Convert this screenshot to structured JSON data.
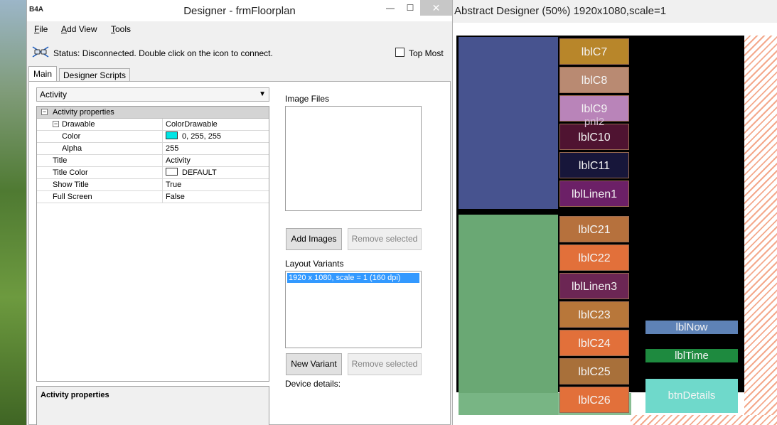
{
  "abstract_designer": {
    "title": "Abstract Designer (50%) 1920x1080,scale=1",
    "labels": [
      {
        "name": "lblC7",
        "text": "lblC7",
        "color": "#b8862a"
      },
      {
        "name": "lblC8",
        "text": "lblC8",
        "color": "#b98a72"
      },
      {
        "name": "lblC9",
        "text": "lblC9",
        "color": "#b984b9"
      },
      {
        "name": "lblC10",
        "text": "lblC10",
        "color": "#4f1331"
      },
      {
        "name": "lblC11",
        "text": "lblC11",
        "color": "#17163a"
      },
      {
        "name": "lblLinen1",
        "text": "lblLinen1",
        "color": "#6c2067"
      },
      {
        "name": "lblC21",
        "text": "lblC21",
        "color": "#b6713d"
      },
      {
        "name": "lblC22",
        "text": "lblC22",
        "color": "#e2703a"
      },
      {
        "name": "lblLinen3",
        "text": "lblLinen3",
        "color": "#6c2654"
      },
      {
        "name": "lblC23",
        "text": "lblC23",
        "color": "#b8773a"
      },
      {
        "name": "lblC24",
        "text": "lblC24",
        "color": "#e2703a"
      },
      {
        "name": "lblC25",
        "text": "lblC25",
        "color": "#a8703a"
      },
      {
        "name": "lblC26",
        "text": "lblC26",
        "color": "#e2703a"
      }
    ],
    "pnl2_label": "pnl2",
    "right_labels": [
      {
        "name": "lblNow",
        "text": "lblNow",
        "color": "#5e82b6"
      },
      {
        "name": "lblTime",
        "text": "lblTime",
        "color": "#1e8a3f"
      },
      {
        "name": "btnDetails",
        "text": "btnDetails",
        "color": "#6fd9cb"
      }
    ]
  },
  "designer": {
    "logo": "B4A",
    "title": "Designer - frmFloorplan",
    "window_buttons": {
      "minimize": "—",
      "maximize": "☐",
      "close": "✕"
    },
    "menu": [
      {
        "key": "F",
        "rest": "ile"
      },
      {
        "key": "A",
        "rest": "dd View"
      },
      {
        "key": "T",
        "rest": "ools"
      }
    ],
    "status": "Status: Disconnected. Double click on the icon to connect.",
    "top_most_label": "Top Most",
    "top_most_checked": false,
    "tabs": [
      "Main",
      "Designer Scripts"
    ],
    "module_select": "Activity",
    "properties": {
      "category": "Activity properties",
      "rows": [
        {
          "name": "Drawable",
          "value": "ColorDrawable"
        },
        {
          "name": "Color",
          "value": "0, 255, 255",
          "swatch": "#00e5e5"
        },
        {
          "name": "Alpha",
          "value": "255"
        },
        {
          "name": "Title",
          "value": "Activity"
        },
        {
          "name": "Title Color",
          "value": "DEFAULT",
          "swatch": "#ffffff"
        },
        {
          "name": "Show Title",
          "value": "True"
        },
        {
          "name": "Full Screen",
          "value": "False"
        }
      ]
    },
    "description_title": "Activity properties",
    "image_files_label": "Image Files",
    "add_images": "Add Images",
    "remove_selected": "Remove selected",
    "layout_variants_label": "Layout Variants",
    "variants": [
      "1920 x 1080, scale = 1 (160 dpi)"
    ],
    "new_variant": "New Variant",
    "device_details": "Device details:"
  }
}
